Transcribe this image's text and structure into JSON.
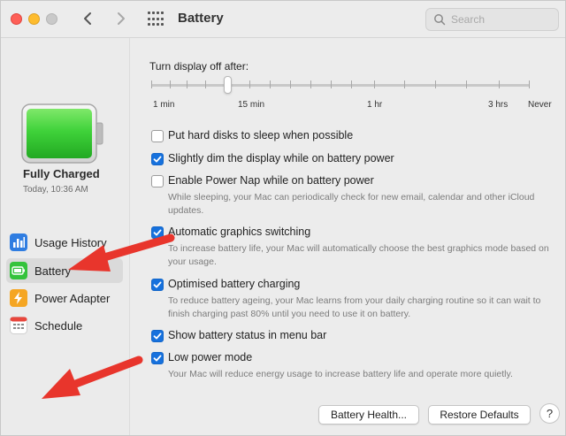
{
  "window": {
    "title": "Battery"
  },
  "search": {
    "placeholder": "Search"
  },
  "sidebar": {
    "status_title": "Fully Charged",
    "status_time": "Today, 10:36 AM",
    "items": [
      {
        "label": "Usage History",
        "icon": "bar-chart-icon"
      },
      {
        "label": "Battery",
        "icon": "battery-icon",
        "selected": true
      },
      {
        "label": "Power Adapter",
        "icon": "power-adapter-icon"
      },
      {
        "label": "Schedule",
        "icon": "calendar-icon"
      }
    ]
  },
  "display_off": {
    "label": "Turn display off after:",
    "ticks": [
      "1 min",
      "15 min",
      "1 hr",
      "3 hrs",
      "Never"
    ],
    "selected": "15 min"
  },
  "options": [
    {
      "label": "Put hard disks to sleep when possible",
      "checked": false,
      "description": ""
    },
    {
      "label": "Slightly dim the display while on battery power",
      "checked": true,
      "description": ""
    },
    {
      "label": "Enable Power Nap while on battery power",
      "checked": false,
      "description": "While sleeping, your Mac can periodically check for new email, calendar and other iCloud updates."
    },
    {
      "label": "Automatic graphics switching",
      "checked": true,
      "description": "To increase battery life, your Mac will automatically choose the best graphics mode based on your usage."
    },
    {
      "label": "Optimised battery charging",
      "checked": true,
      "description": "To reduce battery ageing, your Mac learns from your daily charging routine so it can wait to finish charging past 80% until you need to use it on battery."
    },
    {
      "label": "Show battery status in menu bar",
      "checked": true,
      "description": ""
    },
    {
      "label": "Low power mode",
      "checked": true,
      "description": "Your Mac will reduce energy usage to increase battery life and operate more quietly."
    }
  ],
  "buttons": {
    "battery_health": "Battery Health...",
    "restore_defaults": "Restore Defaults",
    "help": "?"
  },
  "colors": {
    "accent": "#1671dd",
    "battery_fill": "#3fd23a",
    "annotation_arrow": "#e8352c"
  }
}
